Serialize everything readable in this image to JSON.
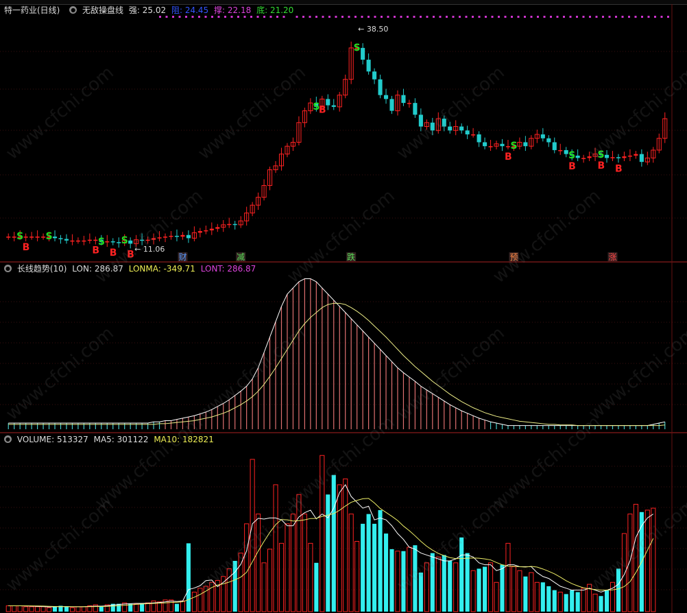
{
  "header": {
    "stock": "特一药业(日线)",
    "indicator": "无敌操盘线",
    "strong_label": "强:",
    "strong_value": "25.02",
    "resist_label": "阻:",
    "resist_value": "24.45",
    "support_label": "撑:",
    "support_value": "22.18",
    "bottom_label": "底:",
    "bottom_value": "21.20"
  },
  "price_panel": {
    "high_label": "38.50",
    "low_label": "11.06",
    "events": [
      {
        "text": "财",
        "i": 30,
        "color": "#5599ff"
      },
      {
        "text": "减",
        "i": 40,
        "color": "#55dd55"
      },
      {
        "text": "跌",
        "i": 59,
        "color": "#55dd55"
      },
      {
        "text": "预",
        "i": 87,
        "color": "#ff8844"
      },
      {
        "text": "涨",
        "i": 104,
        "color": "#ff4444"
      }
    ]
  },
  "lon_panel": {
    "title": "长线趋势(10)",
    "lon_label": "LON:",
    "lon_value": "286.87",
    "lonma_label": "LONMA:",
    "lonma_value": "-349.71",
    "lont_label": "LONT:",
    "lont_value": "286.87"
  },
  "vol_panel": {
    "vol_label": "VOLUME:",
    "vol_value": "513327",
    "ma5_label": "MA5:",
    "ma5_value": "301122",
    "ma10_label": "MA10:",
    "ma10_value": "182821"
  },
  "watermark": "www.cfchi.com",
  "colors": {
    "up": "#ff2222",
    "down": "#22cccc",
    "signal_s": "#22dd22",
    "signal_b": "#ff2222",
    "lon": "#e07070",
    "lonma": "#eeee88",
    "ma5": "#ffffff",
    "ma10": "#eeee66",
    "dots": "#cc33cc"
  },
  "chart_data": [
    {
      "type": "candlestick",
      "ylim": [
        10,
        40
      ],
      "closes": [
        12.0,
        12.0,
        12.0,
        12.0,
        12.0,
        12.0,
        12.0,
        12.0,
        11.8,
        11.7,
        11.5,
        11.5,
        11.5,
        11.5,
        11.6,
        11.6,
        11.3,
        11.4,
        11.3,
        11.2,
        11.5,
        11.1,
        11.6,
        11.5,
        11.6,
        11.8,
        11.9,
        12.0,
        12.1,
        12.0,
        12.2,
        11.8,
        12.5,
        12.7,
        12.8,
        13.0,
        13.2,
        13.5,
        13.6,
        13.5,
        14.0,
        15.0,
        16.0,
        17.0,
        18.5,
        20.5,
        21.0,
        22.5,
        23.5,
        24.0,
        26.5,
        28.0,
        29.0,
        28.5,
        29.5,
        28.7,
        28.5,
        30.0,
        32.0,
        36.0,
        36.0,
        34.5,
        33.0,
        32.0,
        30.0,
        29.5,
        28.0,
        30.0,
        29.0,
        29.0,
        27.5,
        26.0,
        26.5,
        25.5,
        27.0,
        26.0,
        25.5,
        26.0,
        25.5,
        25.0,
        25.0,
        24.0,
        23.5,
        23.5,
        23.8,
        23.5,
        23.5,
        23.5,
        24.0,
        23.5,
        24.5,
        25.0,
        24.5,
        24.0,
        23.0,
        23.0,
        22.5,
        22.3,
        22.0,
        22.0,
        22.2,
        22.5,
        22.4,
        22.0,
        22.1,
        22.0,
        22.2,
        22.3,
        22.5,
        21.5,
        22.0,
        23.0,
        24.5,
        27.0
      ],
      "signals": [
        {
          "i": 2,
          "type": "S"
        },
        {
          "i": 3,
          "type": "B"
        },
        {
          "i": 7,
          "type": "S"
        },
        {
          "i": 15,
          "type": "B"
        },
        {
          "i": 16,
          "type": "S"
        },
        {
          "i": 18,
          "type": "B"
        },
        {
          "i": 20,
          "type": "S"
        },
        {
          "i": 21,
          "type": "B"
        },
        {
          "i": 53,
          "type": "S"
        },
        {
          "i": 54,
          "type": "B"
        },
        {
          "i": 60,
          "type": "S"
        },
        {
          "i": 87,
          "type": "S"
        },
        {
          "i": 86,
          "type": "B"
        },
        {
          "i": 97,
          "type": "S"
        },
        {
          "i": 97,
          "type": "B"
        },
        {
          "i": 102,
          "type": "S"
        },
        {
          "i": 102,
          "type": "B"
        },
        {
          "i": 105,
          "type": "B"
        }
      ]
    },
    {
      "type": "bar",
      "series": [
        {
          "name": "LON",
          "values": [
            10,
            10,
            10,
            10,
            10,
            10,
            10,
            10,
            10,
            10,
            10,
            10,
            10,
            10,
            10,
            10,
            10,
            10,
            10,
            10,
            10,
            10,
            10,
            10,
            10,
            12,
            12,
            14,
            14,
            16,
            18,
            20,
            22,
            25,
            28,
            32,
            37,
            42,
            48,
            55,
            62,
            70,
            82,
            100,
            125,
            150,
            175,
            200,
            220,
            230,
            240,
            245,
            245,
            240,
            230,
            220,
            210,
            200,
            190,
            180,
            170,
            160,
            150,
            140,
            130,
            120,
            110,
            100,
            92,
            85,
            78,
            70,
            64,
            58,
            52,
            46,
            40,
            35,
            30,
            26,
            22,
            18,
            15,
            12,
            10,
            8,
            6,
            6,
            6,
            6,
            6,
            6,
            6,
            6,
            6,
            6,
            6,
            6,
            6,
            6,
            6,
            6,
            6,
            6,
            6,
            6,
            6,
            6,
            6,
            6,
            6,
            8,
            10,
            12
          ]
        },
        {
          "name": "LONMA",
          "values": [
            8,
            8,
            8,
            8,
            8,
            8,
            8,
            8,
            8,
            8,
            8,
            8,
            8,
            8,
            8,
            8,
            8,
            8,
            8,
            8,
            8,
            8,
            8,
            8,
            8,
            8,
            9,
            9,
            10,
            11,
            12,
            13,
            14,
            16,
            18,
            20,
            23,
            26,
            30,
            35,
            40,
            46,
            53,
            62,
            73,
            86,
            100,
            115,
            130,
            145,
            160,
            172,
            182,
            190,
            198,
            203,
            205,
            205,
            203,
            198,
            192,
            185,
            177,
            168,
            159,
            150,
            140,
            130,
            120,
            111,
            102,
            94,
            86,
            78,
            71,
            64,
            57,
            51,
            45,
            40,
            35,
            31,
            27,
            24,
            21,
            19,
            17,
            15,
            13,
            12,
            11,
            10,
            9,
            8,
            8,
            7,
            7,
            7,
            6,
            6,
            6,
            6,
            6,
            6,
            6,
            6,
            6,
            6,
            6,
            6,
            6,
            6,
            6,
            7
          ]
        }
      ]
    },
    {
      "type": "bar",
      "ylim": [
        0,
        850000
      ],
      "volume": [
        30000,
        30000,
        30000,
        25000,
        25000,
        25000,
        25000,
        20000,
        25000,
        30000,
        25000,
        20000,
        25000,
        25000,
        30000,
        35000,
        25000,
        35000,
        40000,
        40000,
        45000,
        40000,
        40000,
        40000,
        45000,
        55000,
        50000,
        60000,
        60000,
        40000,
        55000,
        350000,
        100000,
        120000,
        130000,
        150000,
        160000,
        180000,
        220000,
        260000,
        300000,
        450000,
        780000,
        500000,
        250000,
        320000,
        650000,
        350000,
        450000,
        500000,
        600000,
        500000,
        350000,
        250000,
        800000,
        600000,
        700000,
        650000,
        680000,
        500000,
        360000,
        450000,
        500000,
        450000,
        520000,
        400000,
        320000,
        310000,
        310000,
        330000,
        340000,
        200000,
        250000,
        300000,
        280000,
        290000,
        260000,
        250000,
        380000,
        300000,
        210000,
        220000,
        230000,
        250000,
        150000,
        240000,
        350000,
        230000,
        210000,
        180000,
        200000,
        150000,
        150000,
        130000,
        110000,
        100000,
        90000,
        110000,
        100000,
        120000,
        140000,
        90000,
        80000,
        110000,
        150000,
        220000,
        400000,
        500000,
        550000,
        510000,
        520000,
        530000
      ],
      "ma5": [
        30000,
        30000,
        30000,
        29000,
        28000,
        27000,
        26000,
        24000,
        25000,
        26000,
        26000,
        25000,
        25000,
        25000,
        27000,
        28000,
        28000,
        30000,
        34000,
        37000,
        39000,
        41000,
        42000,
        42000,
        43000,
        45000,
        47000,
        50000,
        54000,
        52000,
        54000,
        113000,
        121000,
        133000,
        159000,
        162000,
        128000,
        150000,
        176000,
        203000,
        242000,
        311000,
        450000,
        478000,
        474000,
        480000,
        480000,
        470000,
        440000,
        440000,
        485000,
        507000,
        520000,
        475000,
        500000,
        480000,
        530000,
        610000,
        650000,
        590000,
        560000,
        530000,
        540000,
        470000,
        480000,
        470000,
        440000,
        400000,
        370000,
        330000,
        320000,
        300000,
        290000,
        280000,
        270000,
        260000,
        260000,
        270000,
        290000,
        290000,
        280000,
        250000,
        240000,
        240000,
        210000,
        220000,
        240000,
        240000,
        230000,
        230000,
        230000,
        200000,
        180000,
        170000,
        150000,
        130000,
        120000,
        110000,
        110000,
        110000,
        120000,
        110000,
        100000,
        110000,
        120000,
        140000,
        190000,
        260000,
        380000,
        440000,
        480000,
        500000
      ]
    }
  ]
}
